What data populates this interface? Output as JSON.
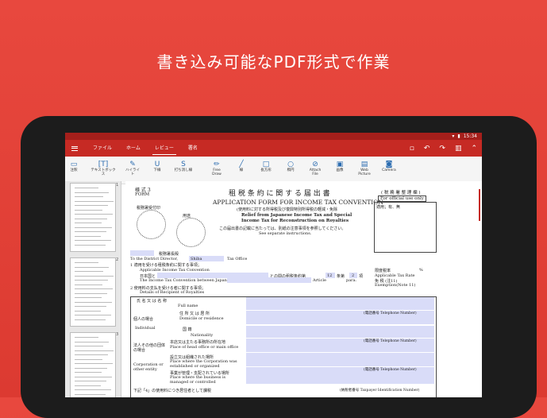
{
  "headline": "書き込み可能なPDF形式で作業",
  "status": {
    "time": "15:34"
  },
  "menu": {
    "tabs": [
      "ファイル",
      "ホーム",
      "レビュー",
      "署名"
    ],
    "active": "レビュー"
  },
  "ribbon": [
    {
      "icon": "comment-icon",
      "glyph": "▭",
      "label": "注釈"
    },
    {
      "icon": "textbox-icon",
      "glyph": "[T]",
      "label": "テキストボックス"
    },
    {
      "icon": "highlight-icon",
      "glyph": "✎",
      "label": "ハイライト"
    },
    {
      "icon": "underline-icon",
      "glyph": "U",
      "label": "下線"
    },
    {
      "icon": "strikethrough-icon",
      "glyph": "S",
      "label": "打ち消し線"
    },
    {
      "icon": "freedraw-icon",
      "glyph": "✏",
      "label": "Free Draw"
    },
    {
      "icon": "line-icon",
      "glyph": "╱",
      "label": "線"
    },
    {
      "icon": "rectangle-icon",
      "glyph": "□",
      "label": "長方形"
    },
    {
      "icon": "ellipse-icon",
      "glyph": "○",
      "label": "楕円"
    },
    {
      "icon": "attach-file-icon",
      "glyph": "⊘",
      "label": "Attach File"
    },
    {
      "icon": "image-icon",
      "glyph": "▣",
      "label": "画像"
    },
    {
      "icon": "web-picture-icon",
      "glyph": "▤",
      "label": "Web Picture"
    },
    {
      "icon": "camera-icon",
      "glyph": "◙",
      "label": "Camera"
    }
  ],
  "thumbnails": {
    "page1": "1",
    "page2": "2",
    "page3": "3"
  },
  "document": {
    "form_no": "様 式 3",
    "form_en": "FORM",
    "title_ja": "租 税 条 約 に 関 す る 届 出 書",
    "title_en": "APPLICATION FORM FOR INCOME TAX CONVENTION",
    "sub1": "(使用料に対する所得税及び復興特別所得税の軽減・免除",
    "sub2": "Relief from Japanese Income Tax and Special",
    "sub3": "Income Tax for Reconstruction on Royalties",
    "note1": "この届出書の記載に当たっては、別紙の注意事項を参照してください。",
    "note2": "See separate instructions.",
    "stamp1": "税務署受付印",
    "stamp2": "用途",
    "official_title": "( 税 務 署 整 理 欄 )",
    "official_en": "For official use only",
    "official_cells": "適用；有、無",
    "to_ja": "税務署長殿",
    "to_en": "To the District Director,",
    "to_office": "Shiba",
    "tax_office": "Tax Office",
    "item1_ja": "1  適用を受ける租税条約に関する事項；",
    "item1_en": "Applicable Income Tax Convention",
    "item1_line": "日本国と",
    "item1_line2": "との間の租税条約第",
    "item1_article": "12",
    "item1_para_ja": "条第",
    "item1_para": "2",
    "item1_end": "項",
    "item1_en2": "The Income Tax Convention between Japan and",
    "item1_en3": "Article",
    "item1_en4": "para.",
    "item2_ja": "2  使用料の支払を受ける者に関する事項；",
    "item2_en": "Details of Recipient of Royalties",
    "rate_ja": "限度税率",
    "rate_en": "Applicable Tax Rate",
    "exempt_ja": "免 税 (注11)",
    "exempt_en": "Exemption(Note 11)",
    "percent": "%",
    "name_ja": "氏     名     又     は     名     称",
    "name_en": "Full name",
    "individual_ja": "個人の場合",
    "individual_en": "Individual",
    "domicile_ja": "住   所   又   は   居   所",
    "domicile_en": "Domicile or residence",
    "nationality_ja": "国            籍",
    "nationality_en": "Nationality",
    "tel": "(電話番号  Telephone Number)",
    "corp_ja": "法人その他の団体の場合",
    "corp_en": "Corporation or other entity",
    "hq_ja": "本店又は主たる事務所の所在地",
    "hq_en": "Place of head office or main office",
    "est_ja": "設立又は組織された場所",
    "est_en": "Place where the Corporation was established or organized",
    "mgmt_ja": "事業が管理・支配されている場所",
    "mgmt_en": "Place where the business is managed or controlled",
    "item_bottom": "下記「4」の使用料につき居住者として課税",
    "taxpayer_id": "(納税者番号  Taxpayer Identification Number)"
  }
}
